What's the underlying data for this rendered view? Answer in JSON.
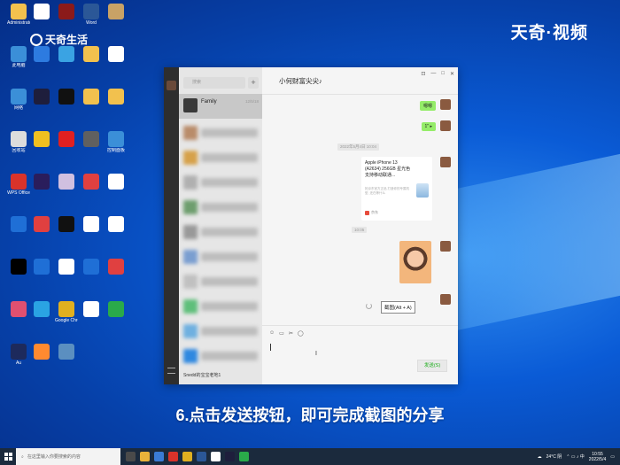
{
  "watermark": {
    "left_logo": "天奇生活",
    "right_logo": "天奇·视频"
  },
  "desktop_icons": [
    {
      "label": "Administrator",
      "color": "#f2c14e"
    },
    {
      "label": "",
      "color": "#ffffff"
    },
    {
      "label": "",
      "color": "#8b1a1a"
    },
    {
      "label": "Word",
      "color": "#2b5797"
    },
    {
      "label": "",
      "color": "#c8a266"
    },
    {
      "label": "此电脑",
      "color": "#3b8fd8"
    },
    {
      "label": "",
      "color": "#2d7be0"
    },
    {
      "label": "",
      "color": "#3aa3e3"
    },
    {
      "label": "",
      "color": "#f2c14e"
    },
    {
      "label": "",
      "color": "#ffffff"
    },
    {
      "label": "网络",
      "color": "#3b8fd8"
    },
    {
      "label": "",
      "color": "#1e1e3c"
    },
    {
      "label": "",
      "color": "#111111"
    },
    {
      "label": "",
      "color": "#f2c14e"
    },
    {
      "label": "",
      "color": "#f2c14e"
    },
    {
      "label": "回收站",
      "color": "#dcdcdc"
    },
    {
      "label": "",
      "color": "#f0c020"
    },
    {
      "label": "",
      "color": "#e02020"
    },
    {
      "label": "",
      "color": "#606060"
    },
    {
      "label": "控制面板",
      "color": "#3b8fd8"
    },
    {
      "label": "WPS Office",
      "color": "#d9332a"
    },
    {
      "label": "",
      "color": "#2a1d5c"
    },
    {
      "label": "",
      "color": "#d0c0e0"
    },
    {
      "label": "",
      "color": "#e04040"
    },
    {
      "label": "",
      "color": "#ffffff"
    },
    {
      "label": "",
      "color": "#1f6fd6"
    },
    {
      "label": "",
      "color": "#e04040"
    },
    {
      "label": "",
      "color": "#111111"
    },
    {
      "label": "",
      "color": "#ffffff"
    },
    {
      "label": "",
      "color": "#ffffff"
    },
    {
      "label": "",
      "color": "#000000"
    },
    {
      "label": "",
      "color": "#1f6fd6"
    },
    {
      "label": "",
      "color": "#ffffff"
    },
    {
      "label": "",
      "color": "#1f6fd6"
    },
    {
      "label": "",
      "color": "#e04040"
    },
    {
      "label": "",
      "color": "#e05070"
    },
    {
      "label": "",
      "color": "#2aa3e3"
    },
    {
      "label": "Google Chrome",
      "color": "#e0b020"
    },
    {
      "label": "",
      "color": "#ffffff"
    },
    {
      "label": "",
      "color": "#2aaa4a"
    },
    {
      "label": "Au",
      "color": "#1d2a5c"
    },
    {
      "label": "",
      "color": "#ff8a30"
    },
    {
      "label": "",
      "color": "#5b8fc0"
    }
  ],
  "wechat": {
    "search_placeholder": "搜索",
    "plus": "+",
    "active_chat": {
      "name": "Family",
      "time": "12/5/18"
    },
    "last_chat_label": "Snedd的宝宝老地1",
    "conversation_title": "小何财富尖尖♪",
    "window_controls": [
      "⊡",
      "—",
      "□",
      "✕"
    ],
    "messages": {
      "sent_1": "嗯嗯",
      "sent_2": "1\" ▸",
      "time_1": "2022年5月4日 10:04",
      "product_title": "Apple iPhone 13 (A2634) 256GB 星光色 支持移动联通...",
      "product_desc": "抢京东官方正品 打造你的专属机型, 还在等什么",
      "product_source": "京东",
      "time_2": "10:05",
      "screenshot_tooltip": "截图(Alt + A)"
    },
    "toolbar_icons": [
      "☺",
      "▭",
      "✂",
      "◯"
    ],
    "send_label": "发送(S)"
  },
  "caption": "6.点击发送按钮，即可完成截图的分享",
  "taskbar": {
    "search_placeholder": "在这里输入你要搜索的内容",
    "weather": "24°C 阴",
    "time": "10:55",
    "date": "2022/5/4"
  }
}
